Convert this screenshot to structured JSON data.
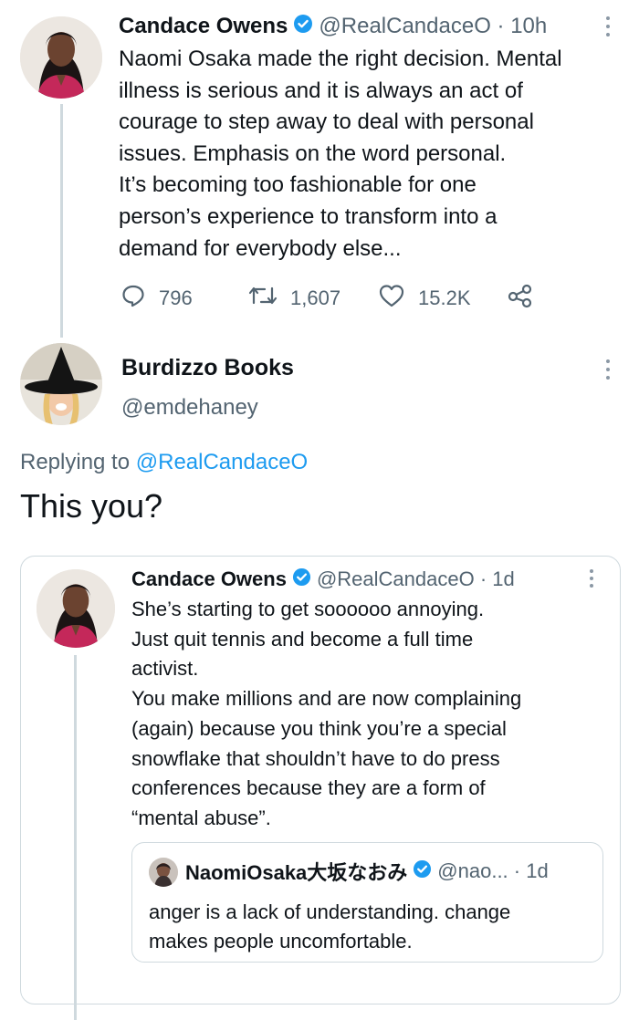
{
  "tweet1": {
    "author": "Candace Owens",
    "handle_time": "@RealCandaceO · 10h",
    "text": "Naomi Osaka made the right decision. Mental\nillness is serious and it is always an act of\ncourage to step away to deal with personal\nissues. Emphasis on the word personal.\nIt’s becoming too fashionable for one\nperson’s experience to transform into a\ndemand for everybody else...",
    "replies": "796",
    "retweets": "1,607",
    "likes": "15.2K"
  },
  "reply": {
    "author": "Burdizzo Books",
    "handle": "@emdehaney",
    "replying_prefix": "Replying to ",
    "replying_handle": "@RealCandaceO",
    "text": "This you?"
  },
  "quoted": {
    "author": "Candace Owens",
    "handle_time": "@RealCandaceO · 1d",
    "text": "She’s starting to get soooooo annoying.\nJust quit tennis and become a full time\nactivist.\nYou make millions and are now complaining\n(again) because you think you’re a special\nsnowflake that shouldn’t have to do press\nconferences because they are a form of\n“mental abuse”."
  },
  "nested": {
    "author": "NaomiOsaka大坂なおみ",
    "handle_time": "@nao... · 1d",
    "text": "anger is a lack of understanding. change\nmakes people uncomfortable."
  },
  "colors": {
    "text": "#0f1419",
    "muted": "#536471",
    "link": "#1d9bf0",
    "verified": "#1d9bf0",
    "border": "#cfd9de"
  },
  "icons": [
    "verified-badge-icon",
    "more-icon",
    "reply-icon",
    "retweet-icon",
    "like-icon",
    "share-icon"
  ]
}
